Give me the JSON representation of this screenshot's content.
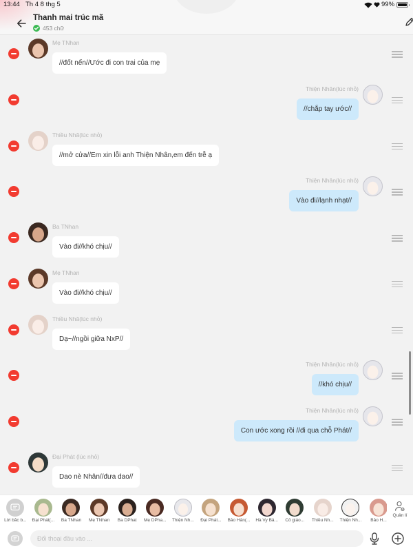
{
  "status_bar": {
    "time": "13:44",
    "date": "Th 4 8 thg 5",
    "battery": "99%"
  },
  "header": {
    "title": "Thanh mai trúc mã",
    "word_count": "453 chữ"
  },
  "messages": [
    {
      "name": "Mẹ TNhan",
      "text": "//đốt nến//Ước đi con trai của mẹ"
    },
    {
      "name": "Thiện Nhân(lúc nhỏ)",
      "text": "//chắp tay ước//"
    },
    {
      "name": "Thiều Nhã(lúc nhỏ)",
      "text": "//mở cửa//Em xin lỗi anh Thiện Nhân,em đến trễ ạ"
    },
    {
      "name": "Thiện Nhân(lúc nhỏ)",
      "text": "Vào đi//lạnh nhạt//"
    },
    {
      "name": "Ba TNhan",
      "text": "Vào đi//khó chịu//"
    },
    {
      "name": "Mẹ TNhan",
      "text": "Vào đi//khó chịu//"
    },
    {
      "name": "Thiều Nhã(lúc nhỏ)",
      "text": "Dạ~//ngồi giữa NxP//"
    },
    {
      "name": "Thiện Nhân(lúc nhỏ)",
      "text": "//khó chịu//"
    },
    {
      "name": "Thiện Nhân(lúc nhỏ)",
      "text": "Con ước xong rồi //đi qua chỗ Phát//"
    },
    {
      "name": "Đại Phát (lúc nhỏ)",
      "text": "Dao nè Nhân//đưa dao//"
    }
  ],
  "characters": [
    {
      "label": "Lời bắc b..."
    },
    {
      "label": "Đại Phát(..."
    },
    {
      "label": "Ba TNhan"
    },
    {
      "label": "Mẹ TNhan"
    },
    {
      "label": "Ba DPhat"
    },
    {
      "label": "Mẹ DPha..."
    },
    {
      "label": "Thiện Nh..."
    },
    {
      "label": "Đại Phát..."
    },
    {
      "label": "Bảo Hân(..."
    },
    {
      "label": "Hà Vy Bả..."
    },
    {
      "label": "Cô giáo..."
    },
    {
      "label": "Thiều Nh..."
    },
    {
      "label": "Thiện Nh..."
    },
    {
      "label": "Bảo H..."
    }
  ],
  "manage": {
    "label": "Quản lí"
  },
  "composer": {
    "placeholder": "Đối thoại đầu vào ..."
  },
  "colors": {
    "background": "#f2f2f2",
    "bubble_self": "#cde9fb",
    "bubble_other": "#ffffff",
    "delete_red": "#f23b30",
    "verified_green": "#3cba54"
  },
  "icons": {
    "back": "back-arrow-icon",
    "edit": "pencil-icon",
    "verified": "check-circle-icon",
    "delete": "minus-circle-icon",
    "drag": "drag-handle-icon",
    "narration": "chat-bubble-icon",
    "manage": "user-settings-icon",
    "composer_mode": "chat-bubble-icon",
    "mic": "microphone-icon",
    "add": "plus-circle-icon",
    "wifi": "wifi-icon",
    "heart": "heart-icon",
    "battery": "battery-icon"
  }
}
